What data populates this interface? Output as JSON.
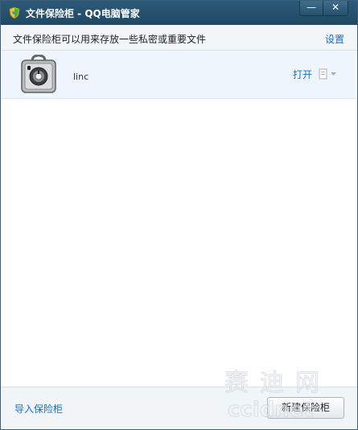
{
  "window": {
    "title": "文件保险柜 - QQ电脑管家",
    "minimize_glyph": "—",
    "close_glyph": "✕"
  },
  "header": {
    "description": "文件保险柜可以用来存放一些私密或重要文件",
    "settings_label": "设置"
  },
  "vaults": [
    {
      "name": "linc",
      "open_label": "打开",
      "icon": "safe-icon"
    }
  ],
  "footer": {
    "import_label": "导入保险柜",
    "new_vault_label": "新建保险柜"
  },
  "watermark": {
    "cn": "赛迪网",
    "en": "ccidnet"
  },
  "colors": {
    "titlebar": "#1f4864",
    "link": "#1c6fb5",
    "row_bg": "#eef5fc"
  }
}
